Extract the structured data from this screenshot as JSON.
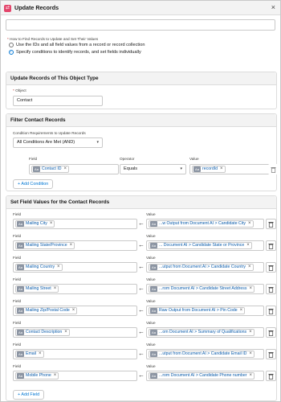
{
  "header": {
    "title": "Update Records",
    "icon": "update-records-icon",
    "close": "×"
  },
  "how_to": {
    "label": "How to Find Records to Update and Set Their Values",
    "options": [
      {
        "label": "Use the IDs and all field values from a record or record collection",
        "selected": false
      },
      {
        "label": "Specify conditions to identify records, and set fields individually",
        "selected": true
      }
    ]
  },
  "object_section": {
    "title": "Update Records of This Object Type",
    "field_label": "Object",
    "value": "Contact"
  },
  "filter_section": {
    "title": "Filter Contact Records",
    "requirement_label": "Condition Requirements to Update Records",
    "requirement_value": "All Conditions Are Met (AND)",
    "field_header": "Field",
    "operator_header": "Operator",
    "value_header": "Value",
    "condition": {
      "field": "Contact ID",
      "operator": "Equals",
      "value": "recordId"
    },
    "add_condition": "+ Add Condition"
  },
  "values_section": {
    "title": "Set Field Values for the Contact Records",
    "field_header": "Field",
    "value_header": "Value",
    "rows": [
      {
        "field": "Mailing City",
        "value": "...w Output from Document AI > Candidate City"
      },
      {
        "field": "Mailing State/Province",
        "value": "... Document AI > Candidate State or Province"
      },
      {
        "field": "Mailing Country",
        "value": "...utput from Document AI > Candidate Country"
      },
      {
        "field": "Mailing Street",
        "value": "...rom Document AI > Candidate Street Address"
      },
      {
        "field": "Mailing Zip/Postal Code",
        "value": "Raw Output from Document AI > Pin Code"
      },
      {
        "field": "Contact Description",
        "value": "...om Document AI > Summary of Qualifications"
      },
      {
        "field": "Email",
        "value": "...utput from Document AI > Candidate Email ID"
      },
      {
        "field": "Mobile Phone",
        "value": "...rom Document AI > Candidate Phone number"
      }
    ],
    "add_field": "+ Add Field"
  },
  "glyphs": {
    "arrow": "←",
    "resource": "Aa",
    "remove": "×",
    "caret": "▾",
    "trash": "🗑"
  }
}
